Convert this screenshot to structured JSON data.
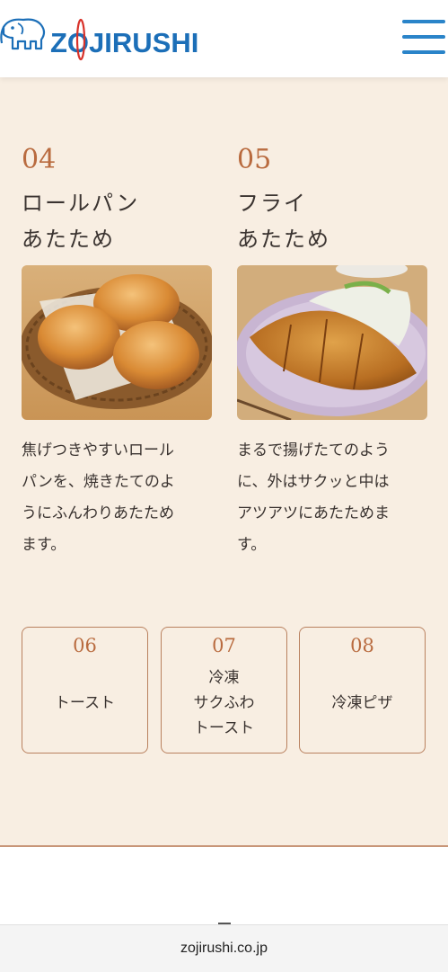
{
  "header": {
    "logo_text": "ZOJIRUSHI",
    "brand_color": "#1c6fb8",
    "menu_icon": "hamburger-menu-icon"
  },
  "features": [
    {
      "number": "04",
      "title_line1": "ロールパン",
      "title_line2": "あたため",
      "photo": "rolls-photo",
      "description_lines": [
        "焦げつきやすいロール",
        "パンを、焼きたてのよ",
        "うにふんわりあたため",
        "ます。"
      ]
    },
    {
      "number": "05",
      "title_line1": "フライ",
      "title_line2": "あたため",
      "photo": "fried-cutlet-photo",
      "description_lines": [
        "まるで揚げたてのよう",
        "に、外はサクッと中は",
        "アツアツにあたためま",
        "す。"
      ]
    }
  ],
  "cards": [
    {
      "number": "06",
      "label_lines": [
        "トースト"
      ]
    },
    {
      "number": "07",
      "label_lines": [
        "冷凍",
        "サクふわ",
        "トースト"
      ]
    },
    {
      "number": "08",
      "label_lines": [
        "冷凍ピザ"
      ]
    }
  ],
  "browser": {
    "url": "zojirushi.co.jp"
  },
  "colors": {
    "accent": "#b96b3f",
    "background": "#f8eee2",
    "menu": "#2a84c9"
  }
}
